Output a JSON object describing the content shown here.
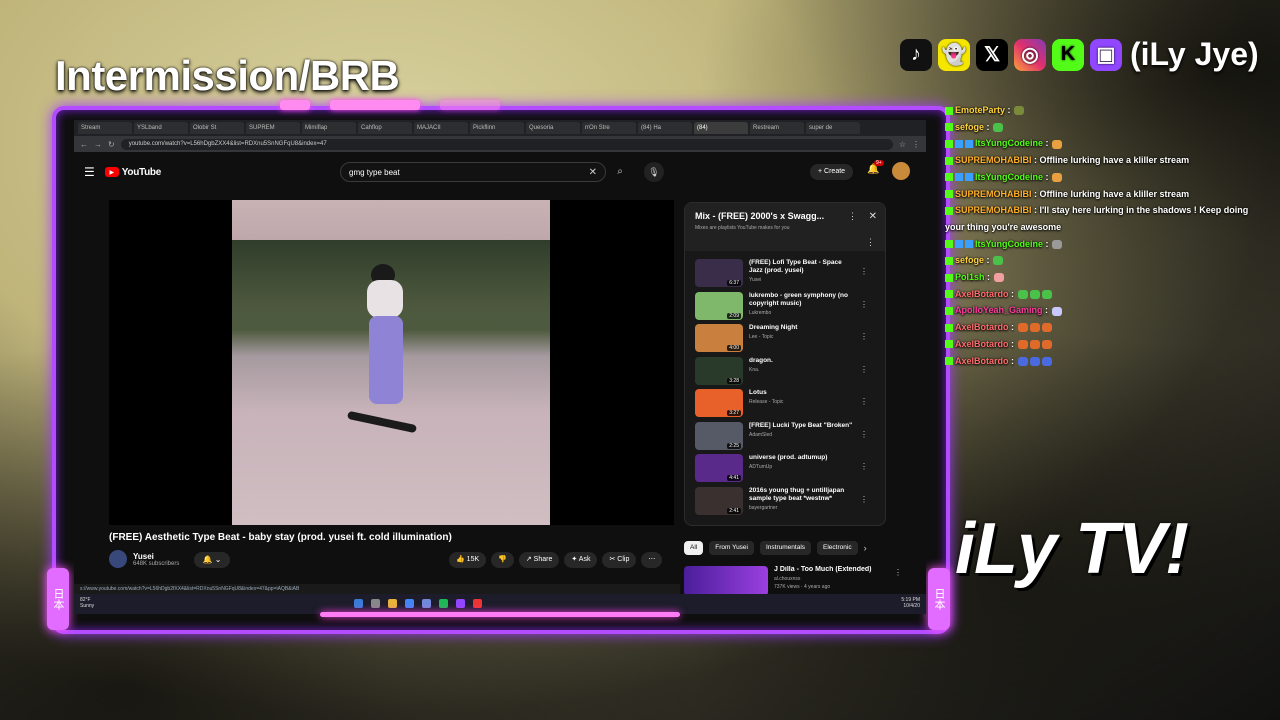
{
  "overlay": {
    "title": "Intermission/BRB",
    "brand": "iLy TV!",
    "handle": "(iLy Jye)",
    "social_icons": [
      "tiktok-icon",
      "snapchat-icon",
      "x-icon",
      "instagram-icon",
      "kick-icon",
      "twitch-icon"
    ],
    "social_glyphs": [
      "♪",
      "👻",
      "𝕏",
      "◎",
      "K",
      "▣"
    ],
    "side_label": "日本"
  },
  "browser": {
    "tabs": [
      "Stream",
      "YSLband",
      "Olobir St",
      "SUPREM",
      "Mimiflap",
      "Cahflop",
      "MAJACII",
      "Pickflinn",
      "Quesoria",
      "rrOn Stre",
      "(84) Ha",
      "(84)",
      "Restream",
      "super de"
    ],
    "url": "youtube.com/watch?v=L56hDgbZXX4&list=RDXnu5SnNGFqU8&index=47"
  },
  "youtube": {
    "logo": "YouTube",
    "search_value": "gmg type beat",
    "create_label": "Create",
    "notif_count": "9+",
    "video_title": "(FREE) Aesthetic Type Beat - baby stay (prod. yusei ft. cold illumination)",
    "channel": "Yusei",
    "subscribers": "648K subscribers",
    "actions": {
      "like": "15K",
      "share": "Share",
      "ask": "Ask",
      "clip": "Clip"
    },
    "status_url": "s://www.youtube.com/watch?v=L56hDgb2fXX4&list=RDXnu5SnNGFqU8&index=47&pp=iAQB&iAB"
  },
  "playlist": {
    "title": "Mix - (FREE) 2000's x Swagg...",
    "subtitle": "Mixes are playlists YouTube makes for you",
    "items": [
      {
        "title": "(FREE) Lofi Type Beat - Space Jazz (prod. yusei)",
        "artist": "Yusei",
        "duration": "6:37",
        "color": "#3a2d4a"
      },
      {
        "title": "lukrembo - green symphony (no copyright music)",
        "artist": "Lukrembo",
        "duration": "2:09",
        "color": "#7fb86a"
      },
      {
        "title": "Dreaming Night",
        "artist": "Lee - Topic",
        "duration": "4:00",
        "color": "#c9803e"
      },
      {
        "title": "dragon.",
        "artist": "Kna.",
        "duration": "3:28",
        "color": "#2a3a2a"
      },
      {
        "title": "Lotus",
        "artist": "Release - Topic",
        "duration": "3:27",
        "color": "#e8602a"
      },
      {
        "title": "[FREE] Lucki Type Beat \"Broken\"",
        "artist": "AdamSled",
        "duration": "2:25",
        "color": "#555a66"
      },
      {
        "title": "universe (prod. adtumup)",
        "artist": "ADTumUp",
        "duration": "4:41",
        "color": "#5a2a8a"
      },
      {
        "title": "2016s young thug + untilljapan sample type beat *westnw*",
        "artist": "bayergartner",
        "duration": "2:41",
        "color": "#3a3030"
      }
    ]
  },
  "chips": [
    "All",
    "From Yusei",
    "Instrumentals",
    "Electronic"
  ],
  "recommended": {
    "title": "J Dilla - Too Much (Extended)",
    "channel": "al.chouxnss",
    "meta": "737K views · 4 years ago"
  },
  "taskbar": {
    "weather_temp": "82°F",
    "weather_desc": "Sunny",
    "time": "5:19 PM",
    "date": "10/4/20"
  },
  "chat": [
    {
      "user": "EmoteParty",
      "color": "#ffd23c",
      "text": "",
      "emotes": [
        "#7a8a3a"
      ]
    },
    {
      "user": "sefoge",
      "color": "#ffd23c",
      "text": "",
      "emotes": [
        "#4ac24a"
      ]
    },
    {
      "user": "ItsYungCodeine",
      "color": "#53fc18",
      "text": "",
      "emotes": [
        "#e8a040"
      ],
      "badges": 3
    },
    {
      "user": "SUPREMOHABIBI",
      "color": "#ffb02a",
      "text": "Offline lurking have a kliller stream",
      "emotes": []
    },
    {
      "user": "ItsYungCodeine",
      "color": "#53fc18",
      "text": "",
      "emotes": [
        "#e8a040"
      ],
      "badges": 3
    },
    {
      "user": "SUPREMOHABIBI",
      "color": "#ffb02a",
      "text": "Offline lurking have a kliller stream",
      "emotes": []
    },
    {
      "user": "SUPREMOHABIBI",
      "color": "#ffb02a",
      "text": "I'll stay here lurking in the shadows ! Keep doing your thing you're awesome",
      "emotes": []
    },
    {
      "user": "ItsYungCodeine",
      "color": "#53fc18",
      "text": "",
      "emotes": [
        "#9a9a9a"
      ],
      "badges": 3
    },
    {
      "user": "sefoge",
      "color": "#ffd23c",
      "text": "",
      "emotes": [
        "#4ac24a"
      ]
    },
    {
      "user": "Pol1sh",
      "color": "#53fc18",
      "text": "",
      "emotes": [
        "#f0a0a0"
      ]
    },
    {
      "user": "AxelBotardo",
      "color": "#ff6b6b",
      "text": "",
      "emotes": [
        "#4ac24a",
        "#4ac24a",
        "#4ac24a"
      ]
    },
    {
      "user": "ApolloYeah_Gaming",
      "color": "#ff3ca0",
      "text": "",
      "emotes": [
        "#c9c9ff"
      ]
    },
    {
      "user": "AxelBotardo",
      "color": "#ff6b6b",
      "text": "",
      "emotes": [
        "#e06a2a",
        "#e06a2a",
        "#e06a2a"
      ]
    },
    {
      "user": "AxelBotardo",
      "color": "#ff6b6b",
      "text": "",
      "emotes": [
        "#e06a2a",
        "#e06a2a",
        "#e06a2a"
      ]
    },
    {
      "user": "AxelBotardo",
      "color": "#ff6b6b",
      "text": "",
      "emotes": [
        "#4a6ae0",
        "#4a6ae0",
        "#4a6ae0"
      ]
    }
  ]
}
